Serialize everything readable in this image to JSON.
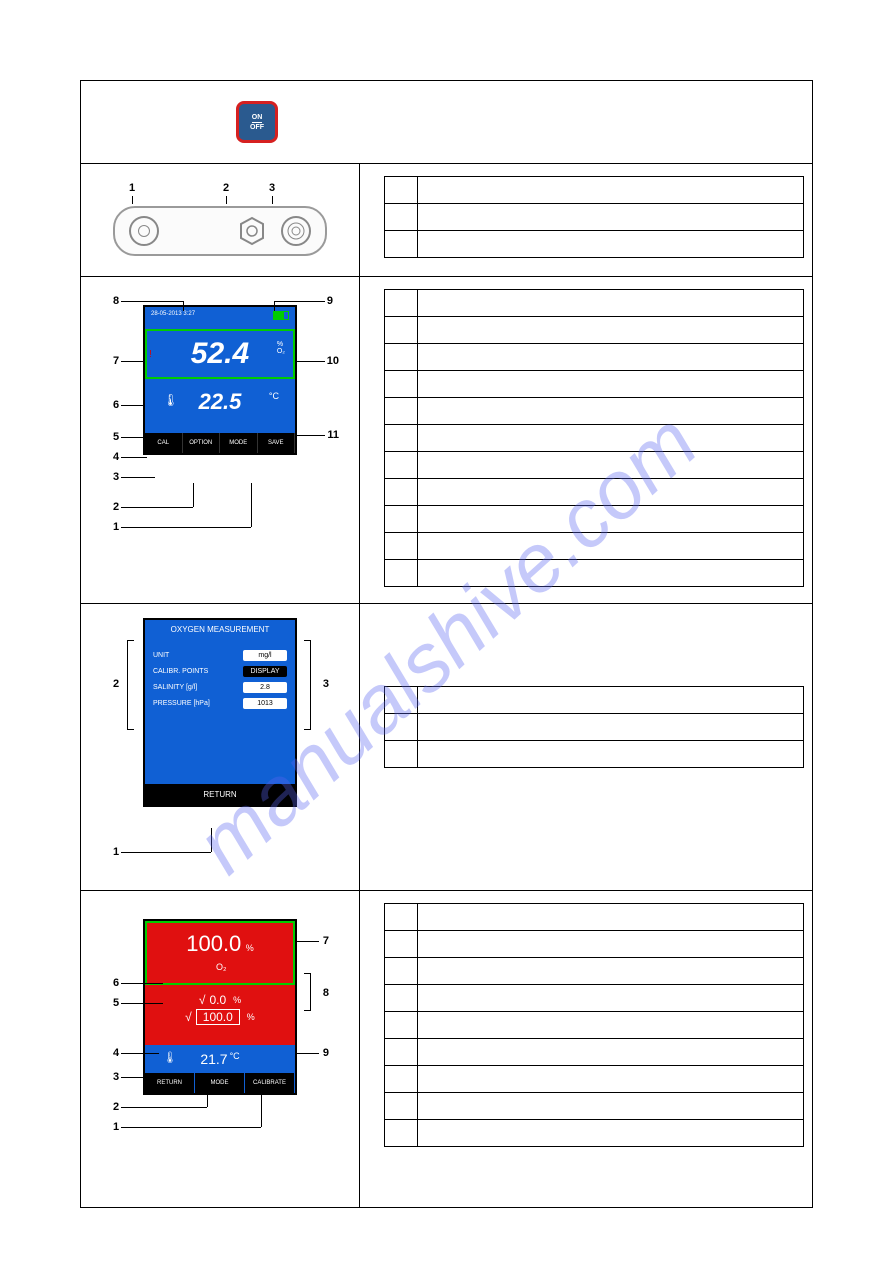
{
  "watermark": "manualshive.com",
  "onoff": {
    "top": "ON",
    "bottom": "OFF"
  },
  "connectors": {
    "labels": [
      "1",
      "2",
      "3"
    ]
  },
  "screen1": {
    "datetime": "28-05-2013   3:27",
    "main_value": "52.4",
    "main_unit": "%\nO₂",
    "temp_value": "22.5",
    "temp_unit": "°C",
    "buttons": [
      "CAL",
      "OPTION",
      "MODE",
      "SAVE"
    ],
    "callouts_left": [
      "8",
      "7",
      "6",
      "5",
      "4",
      "3",
      "2",
      "1"
    ],
    "callouts_right": [
      "9",
      "10",
      "11"
    ]
  },
  "screen2": {
    "title": "OXYGEN MEASUREMENT",
    "rows": [
      {
        "label": "UNIT",
        "value": "mg/l",
        "dark": false
      },
      {
        "label": "CALIBR. POINTS",
        "value": "DISPLAY",
        "dark": true
      },
      {
        "label": "SALINITY  [g/l]",
        "value": "2.8",
        "dark": false
      },
      {
        "label": "PRESSURE  [hPa]",
        "value": "1013",
        "dark": false
      }
    ],
    "return": "RETURN",
    "callouts": [
      "1",
      "2",
      "3"
    ]
  },
  "screen3": {
    "top_value": "100.0",
    "top_unit": "%\nO₂",
    "line1_value": "0.0",
    "line1_unit": "%",
    "line2_value": "100.0",
    "line2_unit": "%",
    "temp_value": "21.7",
    "temp_unit": "°C",
    "buttons": [
      "RETURN",
      "MODE",
      "CALIBRATE"
    ],
    "callouts_left": [
      "6",
      "5",
      "4",
      "3",
      "2",
      "1"
    ],
    "callouts_right": [
      "7",
      "8",
      "9"
    ]
  },
  "tables": {
    "t1_rows": 3,
    "t2_rows": 11,
    "t3_rows": 3,
    "t4_rows": 9
  }
}
